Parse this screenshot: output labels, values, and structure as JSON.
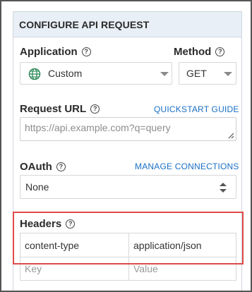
{
  "panel": {
    "title": "CONFIGURE API REQUEST"
  },
  "application": {
    "label": "Application",
    "value": "Custom"
  },
  "method": {
    "label": "Method",
    "value": "GET"
  },
  "request_url": {
    "label": "Request URL",
    "link": "QUICKSTART GUIDE",
    "placeholder": "https://api.example.com?q=query"
  },
  "oauth": {
    "label": "OAuth",
    "link": "MANAGE CONNECTIONS",
    "value": "None"
  },
  "headers": {
    "label": "Headers",
    "rows": [
      {
        "key": "content-type",
        "value": "application/json"
      }
    ],
    "new_row": {
      "key_placeholder": "Key",
      "value_placeholder": "Value"
    }
  },
  "icons": {
    "help": "question-circle-icon",
    "globe": "globe-icon",
    "dropdown": "caret-down-icon",
    "stepper": "up-down-caret-icon",
    "resize": "resize-handle-icon"
  },
  "colors": {
    "header_bg": "#e8eff6",
    "link": "#1a6fc4",
    "highlight": "#e04a4a",
    "globe": "#2e8b57"
  }
}
